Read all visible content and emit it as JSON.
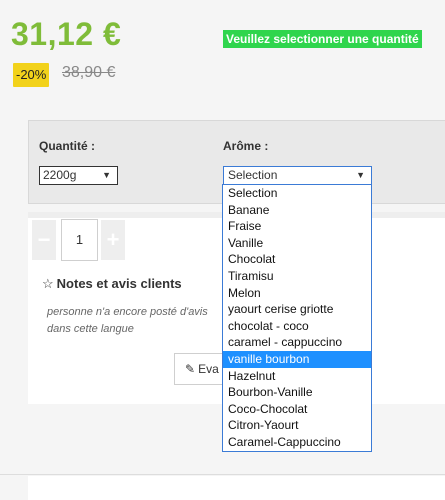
{
  "product": {
    "price": "31,12 €",
    "discount": "-20%",
    "old_price": "38,90 €",
    "warning": "Veuillez selectionner une quantité"
  },
  "options": {
    "quantity_label": "Quantité :",
    "quantity_value": "2200g",
    "arome_label": "Arôme :",
    "arome_value": "Selection",
    "arrow_glyph": "▼"
  },
  "cart": {
    "minus": "−",
    "plus": "+",
    "quantity": "1"
  },
  "reviews": {
    "star_glyph": "☆",
    "title": "Notes et avis clients",
    "empty_text": "personne n'a encore posté d'avis dans cette langue",
    "write_button": "Eva",
    "pencil_glyph": "✎"
  },
  "arome_dropdown": {
    "highlighted_index": 10,
    "options": [
      "Selection",
      "Banane",
      "Fraise",
      "Vanille",
      "Chocolat",
      "Tiramisu",
      "Melon",
      "yaourt cerise griotte",
      "chocolat - coco",
      "caramel - cappuccino",
      "vanille bourbon",
      "Hazelnut",
      "Bourbon-Vanille",
      "Coco-Chocolat",
      "Citron-Yaourt",
      "Caramel-Cappuccino"
    ]
  },
  "colors": {
    "price_green": "#7fbc39",
    "warning_bg": "#2fd54d",
    "discount_bg": "#f2d21b",
    "highlight_blue": "#1e90ff"
  }
}
